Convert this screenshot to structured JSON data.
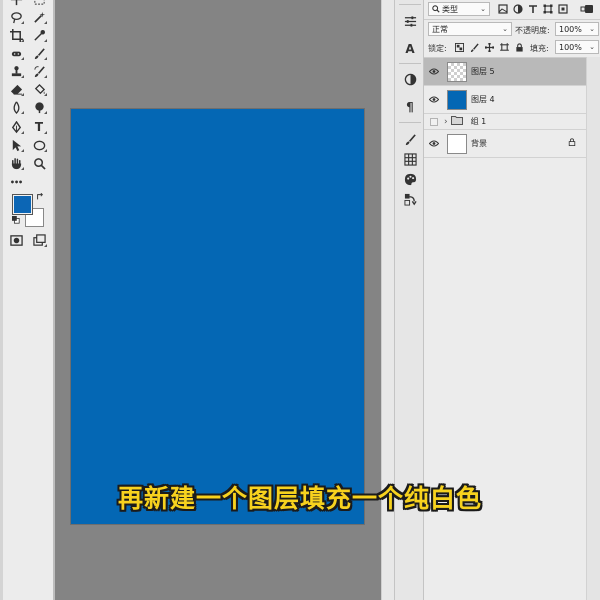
{
  "colors": {
    "foreground": "#0c66b5",
    "background": "#ffffff",
    "document_fill": "#0467b4",
    "subtitle": "#f7d21e",
    "selected_row": "#b9b9b9"
  },
  "tools": [
    {
      "name": "move-tool-icon"
    },
    {
      "name": "artboard-tool-icon"
    },
    {
      "name": "lasso-tool-icon"
    },
    {
      "name": "magic-wand-tool-icon"
    },
    {
      "name": "crop-tool-icon"
    },
    {
      "name": "eyedropper-tool-icon"
    },
    {
      "name": "healing-brush-tool-icon"
    },
    {
      "name": "brush-tool-icon"
    },
    {
      "name": "clone-stamp-tool-icon"
    },
    {
      "name": "history-brush-tool-icon"
    },
    {
      "name": "eraser-tool-icon"
    },
    {
      "name": "paint-bucket-tool-icon"
    },
    {
      "name": "blur-tool-icon"
    },
    {
      "name": "dodge-tool-icon"
    },
    {
      "name": "pen-tool-icon"
    },
    {
      "name": "type-tool-icon",
      "glyph": "T"
    },
    {
      "name": "path-selection-tool-icon"
    },
    {
      "name": "ellipse-tool-icon"
    },
    {
      "name": "hand-tool-icon"
    },
    {
      "name": "zoom-tool-icon"
    },
    {
      "name": "more-tools-icon",
      "glyph": "•••"
    }
  ],
  "dock": [
    {
      "name": "properties-panel-icon"
    },
    {
      "name": "character-panel-icon",
      "glyph": "A"
    },
    {
      "name": "adjustments-panel-icon"
    },
    {
      "name": "paragraph-panel-icon",
      "glyph": "¶"
    },
    {
      "name": "brushes-panel-icon"
    },
    {
      "name": "swatches-panel-icon"
    },
    {
      "name": "color-panel-icon"
    },
    {
      "name": "history-panel-icon"
    }
  ],
  "layers_panel": {
    "filter_kind": "类型",
    "blend_mode": "正常",
    "opacity_label": "不透明度:",
    "opacity_value": "100%",
    "lock_label": "锁定:",
    "fill_label": "填充:",
    "fill_value": "100%",
    "layers": [
      {
        "name": "图层 5",
        "thumb": "checker",
        "visible": true,
        "selected": true
      },
      {
        "name": "图层 4",
        "thumb": "blue",
        "visible": true,
        "selected": false
      },
      {
        "name": "组 1",
        "thumb": "group",
        "visible": false,
        "selected": false
      },
      {
        "name": "背景",
        "thumb": "white",
        "visible": true,
        "selected": false,
        "locked": true
      }
    ]
  },
  "subtitle": "再新建一个图层填充一个纯白色"
}
